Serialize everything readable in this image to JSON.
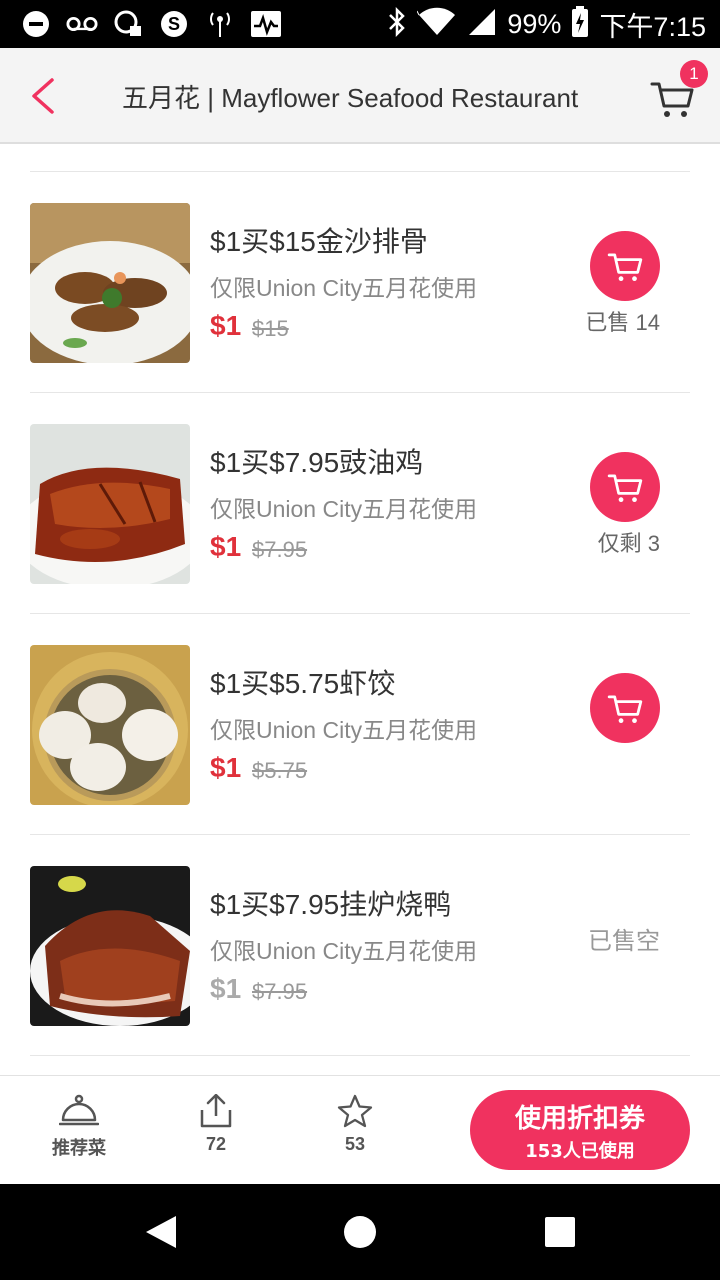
{
  "status_bar": {
    "battery": "99%",
    "time": "下午7:15"
  },
  "header": {
    "title": "五月花 | Mayflower Seafood Restaurant",
    "cart_count": "1"
  },
  "items": [
    {
      "name": "$1买$15金沙排骨",
      "subtitle": "仅限Union City五月花使用",
      "price": "$1",
      "original_price": "$15",
      "stock_text": "已售 14",
      "state": "available"
    },
    {
      "name": "$1买$7.95豉油鸡",
      "subtitle": "仅限Union City五月花使用",
      "price": "$1",
      "original_price": "$7.95",
      "stock_text": "仅剩 3",
      "state": "available"
    },
    {
      "name": "$1买$5.75虾饺",
      "subtitle": "仅限Union City五月花使用",
      "price": "$1",
      "original_price": "$5.75",
      "stock_text": "",
      "state": "available"
    },
    {
      "name": "$1买$7.95挂炉烧鸭",
      "subtitle": "仅限Union City五月花使用",
      "price": "$1",
      "original_price": "$7.95",
      "stock_text": "已售空",
      "state": "sold_out"
    }
  ],
  "bottom_bar": {
    "recommend_label": "推荐菜",
    "share_count": "72",
    "favorite_count": "53",
    "coupon_label": "使用折扣券",
    "coupon_sub": "153人已使用"
  },
  "colors": {
    "accent": "#f0325f",
    "price_red": "#e0313b"
  }
}
